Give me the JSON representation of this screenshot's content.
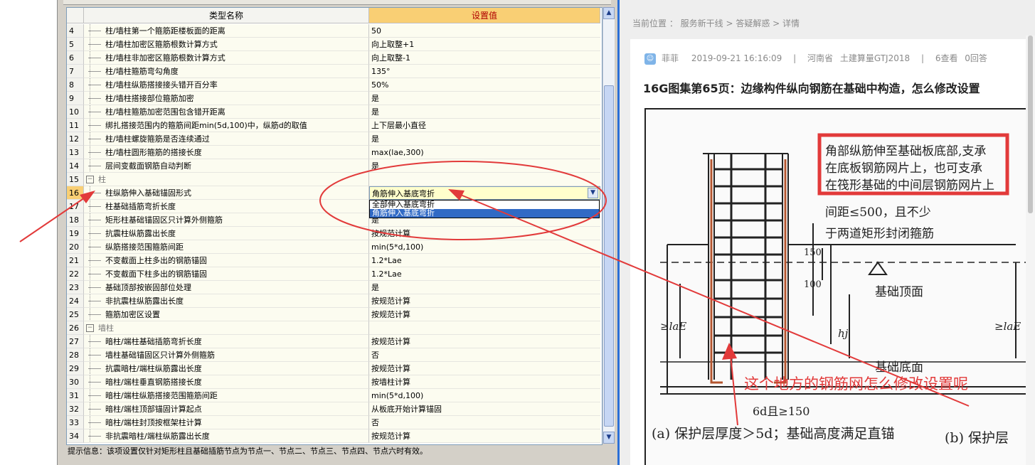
{
  "grid": {
    "header_name": "类型名称",
    "header_value": "设置值",
    "rows": [
      {
        "n": "4",
        "name": "柱/墙柱第一个箍筋距楼板面的距离",
        "value": "50",
        "type": "item"
      },
      {
        "n": "5",
        "name": "柱/墙柱加密区箍筋根数计算方式",
        "value": "向上取整+1",
        "type": "item"
      },
      {
        "n": "6",
        "name": "柱/墙柱非加密区箍筋根数计算方式",
        "value": "向上取整-1",
        "type": "item"
      },
      {
        "n": "7",
        "name": "柱/墙柱箍筋弯勾角度",
        "value": "135°",
        "type": "item"
      },
      {
        "n": "8",
        "name": "柱/墙柱纵筋搭接接头错开百分率",
        "value": "50%",
        "type": "item"
      },
      {
        "n": "9",
        "name": "柱/墙柱搭接部位箍筋加密",
        "value": "是",
        "type": "item"
      },
      {
        "n": "10",
        "name": "柱/墙柱箍筋加密范围包含错开距离",
        "value": "是",
        "type": "item"
      },
      {
        "n": "11",
        "name": "绑扎搭接范围内的箍筋间距min(5d,100)中，纵筋d的取值",
        "value": "上下层最小直径",
        "type": "item"
      },
      {
        "n": "12",
        "name": "柱/墙柱螺旋箍筋是否连续通过",
        "value": "是",
        "type": "item"
      },
      {
        "n": "13",
        "name": "柱/墙柱圆形箍筋的搭接长度",
        "value": "max(lae,300)",
        "type": "item"
      },
      {
        "n": "14",
        "name": "层间变截面钢筋自动判断",
        "value": "是",
        "type": "item"
      },
      {
        "n": "15",
        "name": "柱",
        "value": "",
        "type": "group"
      },
      {
        "n": "16",
        "name": "柱纵筋伸入基础锚固形式",
        "value": "角筋伸入基底弯折",
        "type": "selected"
      },
      {
        "n": "17",
        "name": "柱基础插筋弯折长度",
        "value": "",
        "type": "item"
      },
      {
        "n": "18",
        "name": "矩形柱基础锚固区只计算外侧箍筋",
        "value": "是",
        "type": "item"
      },
      {
        "n": "19",
        "name": "抗震柱纵筋露出长度",
        "value": "按规范计算",
        "type": "item"
      },
      {
        "n": "20",
        "name": "纵筋搭接范围箍筋间距",
        "value": "min(5*d,100)",
        "type": "item"
      },
      {
        "n": "21",
        "name": "不变截面上柱多出的钢筋锚固",
        "value": "1.2*Lae",
        "type": "item"
      },
      {
        "n": "22",
        "name": "不变截面下柱多出的钢筋锚固",
        "value": "1.2*Lae",
        "type": "item"
      },
      {
        "n": "23",
        "name": "基础顶部按嵌固部位处理",
        "value": "是",
        "type": "item"
      },
      {
        "n": "24",
        "name": "非抗震柱纵筋露出长度",
        "value": "按规范计算",
        "type": "item"
      },
      {
        "n": "25",
        "name": "箍筋加密区设置",
        "value": "按规范计算",
        "type": "item"
      },
      {
        "n": "26",
        "name": "墙柱",
        "value": "",
        "type": "group"
      },
      {
        "n": "27",
        "name": "暗柱/端柱基础插筋弯折长度",
        "value": "按规范计算",
        "type": "item"
      },
      {
        "n": "28",
        "name": "墙柱基础锚固区只计算外侧箍筋",
        "value": "否",
        "type": "item"
      },
      {
        "n": "29",
        "name": "抗震暗柱/端柱纵筋露出长度",
        "value": "按规范计算",
        "type": "item"
      },
      {
        "n": "30",
        "name": "暗柱/端柱垂直钢筋搭接长度",
        "value": "按墙柱计算",
        "type": "item"
      },
      {
        "n": "31",
        "name": "暗柱/端柱纵筋搭接范围箍筋间距",
        "value": "min(5*d,100)",
        "type": "item"
      },
      {
        "n": "32",
        "name": "暗柱/端柱顶部锚固计算起点",
        "value": "从板底开始计算锚固",
        "type": "item"
      },
      {
        "n": "33",
        "name": "暗柱/端柱封顶按框架柱计算",
        "value": "否",
        "type": "item"
      },
      {
        "n": "34",
        "name": "非抗震暗柱/端柱纵筋露出长度",
        "value": "按规范计算",
        "type": "item"
      }
    ],
    "dropdown_options": [
      "全部伸入基底弯折",
      "角筋伸入基底弯折"
    ],
    "dropdown_highlighted": 1
  },
  "hint": "提示信息：该项设置仅针对矩形柱且基础插筋节点为节点一、节点二、节点三、节点四、节点六时有效。",
  "article": {
    "breadcrumb": "当前位置 ： 服务新干线 > 答疑解惑 > 详情",
    "author": "菲菲",
    "date": "2019-09-21 16:16:09",
    "region": "河南省",
    "software": "土建算量GTJ2018",
    "views": "6查看",
    "answers": "0回答",
    "title": "16G图集第65页：边缘构件纵向钢筋在基础中构造，怎么修改设置"
  },
  "figure": {
    "boxed_text": [
      "角部纵筋伸至基础板底部,支承",
      "在底板钢筋网片上，也可支承",
      "在筏形基础的中间层钢筋网片上"
    ],
    "spacing_text": [
      "间距≤500，且不少",
      "于两道矩形封闭箍筋"
    ],
    "label_top": "基础顶面",
    "label_bottom": "基础底面",
    "dim_150": "150",
    "dim_100": "100",
    "dim_hj": "hj",
    "dim_lae_left": "≥laE",
    "dim_lae_right": "≥laE",
    "dim_6d": "6d且≥150",
    "caption_a": "(a) 保护层厚度＞5d；基础高度满足直锚",
    "caption_b": "(b) 保护层"
  },
  "annotation": {
    "note": "这个地方的钢筋网怎么修改设置呢",
    "color": "#e23a3a"
  }
}
